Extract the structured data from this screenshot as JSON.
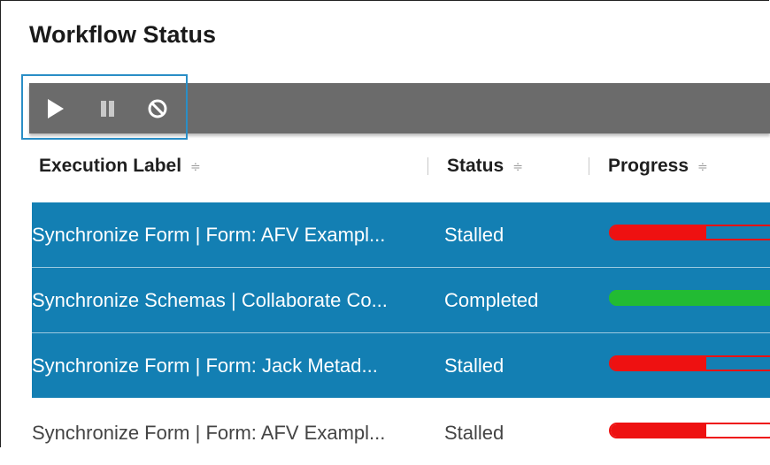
{
  "panel": {
    "title": "Workflow Status"
  },
  "toolbar": {
    "play": "play-icon",
    "pause": "pause-icon",
    "cancel": "cancel-icon"
  },
  "table": {
    "columns": [
      {
        "label": "Execution Label",
        "sort": "≑"
      },
      {
        "label": "Status",
        "sort": "≑"
      },
      {
        "label": "Progress",
        "sort": "≑"
      }
    ],
    "rows": [
      {
        "label": "Synchronize Form | Form: AFV Exampl...",
        "status": "Stalled",
        "progress": 0.58,
        "selected": true
      },
      {
        "label": "Synchronize Schemas | Collaborate Co...",
        "status": "Completed",
        "progress": 1.0,
        "selected": true
      },
      {
        "label": "Synchronize Form | Form: Jack Metad...",
        "status": "Stalled",
        "progress": 0.58,
        "selected": true
      },
      {
        "label": "Synchronize Form | Form: AFV Exampl...",
        "status": "Stalled",
        "progress": 0.58,
        "selected": false
      }
    ]
  },
  "colors": {
    "selection": "#137fb3",
    "stalled": "#ee1111",
    "completed": "#22bb33",
    "toolbar": "#6b6b6b"
  }
}
